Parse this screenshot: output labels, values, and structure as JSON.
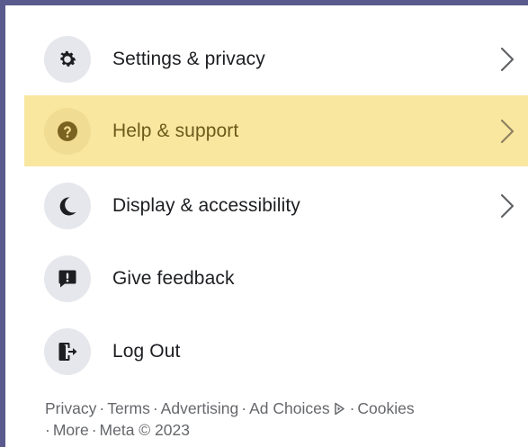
{
  "menu": {
    "items": [
      {
        "label": "Settings & privacy",
        "icon": "gear-icon",
        "chevron": true,
        "highlighted": false
      },
      {
        "label": "Help & support",
        "icon": "question-icon",
        "chevron": true,
        "highlighted": true
      },
      {
        "label": "Display & accessibility",
        "icon": "moon-icon",
        "chevron": true,
        "highlighted": false
      },
      {
        "label": "Give feedback",
        "icon": "feedback-icon",
        "chevron": false,
        "highlighted": false
      },
      {
        "label": "Log Out",
        "icon": "logout-icon",
        "chevron": false,
        "highlighted": false
      }
    ]
  },
  "footer": {
    "privacy": "Privacy",
    "terms": "Terms",
    "advertising": "Advertising",
    "ad_choices": "Ad Choices",
    "cookies": "Cookies",
    "more": "More",
    "meta": "Meta © 2023",
    "separator": "·"
  },
  "colors": {
    "highlight_bg": "#f9e7a0",
    "highlight_text": "#6b5a1a",
    "icon_bg": "#e6e7ec",
    "text": "#1c1e21",
    "muted": "#65676b"
  }
}
